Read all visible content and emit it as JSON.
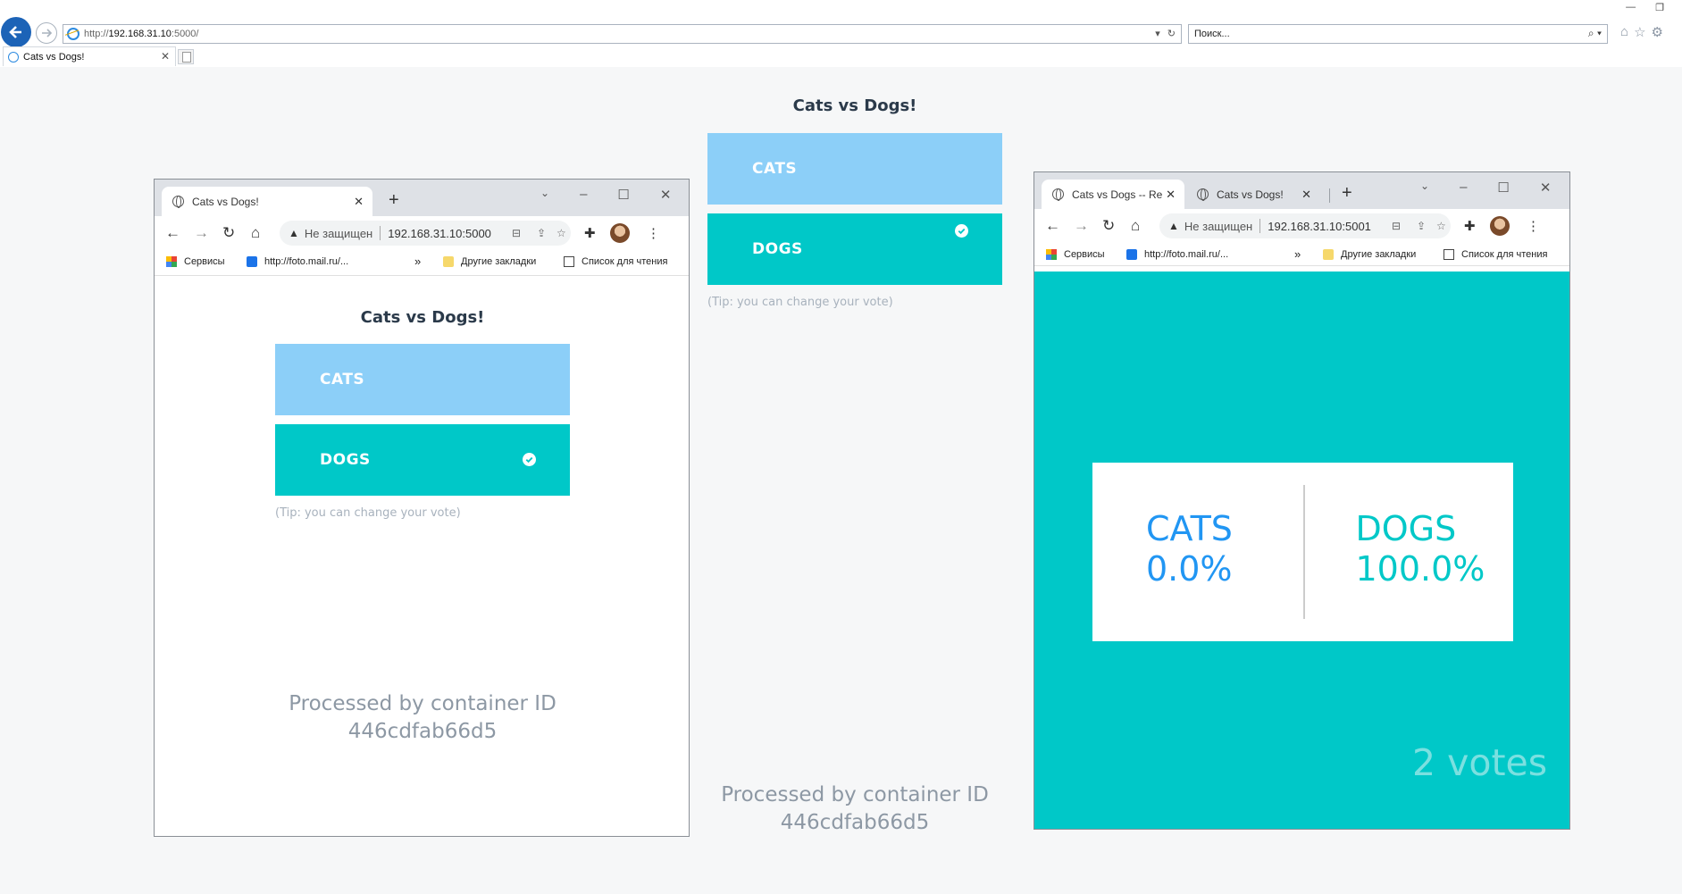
{
  "ie": {
    "url_prefix": "http://",
    "url_host": "192.168.31.10",
    "url_rest": ":5000/",
    "search_placeholder": "Поиск...",
    "tab_title": "Cats vs Dogs!"
  },
  "main": {
    "title": "Cats vs Dogs!",
    "cats_label": "CATS",
    "dogs_label": "DOGS",
    "selected": "DOGS",
    "tip": "(Tip: you can change your vote)",
    "processed_line1": "Processed by container ID",
    "processed_line2": "446cdfab66d5"
  },
  "left_browser": {
    "tab_title": "Cats vs Dogs!",
    "not_secure": "Не защищен",
    "address": "192.168.31.10:5000",
    "bookmarks": {
      "services": "Сервисы",
      "mail": "http://foto.mail.ru/...",
      "more": "»",
      "other": "Другие закладки",
      "reading": "Список для чтения"
    },
    "page": {
      "title": "Cats vs Dogs!",
      "cats_label": "CATS",
      "dogs_label": "DOGS",
      "tip": "(Tip: you can change your vote)",
      "processed_line1": "Processed by container ID",
      "processed_line2": "446cdfab66d5"
    }
  },
  "right_browser": {
    "tab1_title": "Cats vs Dogs -- Re",
    "tab2_title": "Cats vs Dogs!",
    "not_secure": "Не защищен",
    "address": "192.168.31.10:5001",
    "bookmarks": {
      "services": "Сервисы",
      "mail": "http://foto.mail.ru/...",
      "more": "»",
      "other": "Другие закладки",
      "reading": "Список для чтения"
    },
    "result": {
      "cats_label": "CATS",
      "cats_pct": "0.0%",
      "dogs_label": "DOGS",
      "dogs_pct": "100.0%",
      "votes": "2 votes"
    }
  },
  "colors": {
    "cats": "#8ccff8",
    "dogs": "#00c8c8",
    "cats_result": "#2196f3",
    "dogs_result": "#00c8c8"
  }
}
